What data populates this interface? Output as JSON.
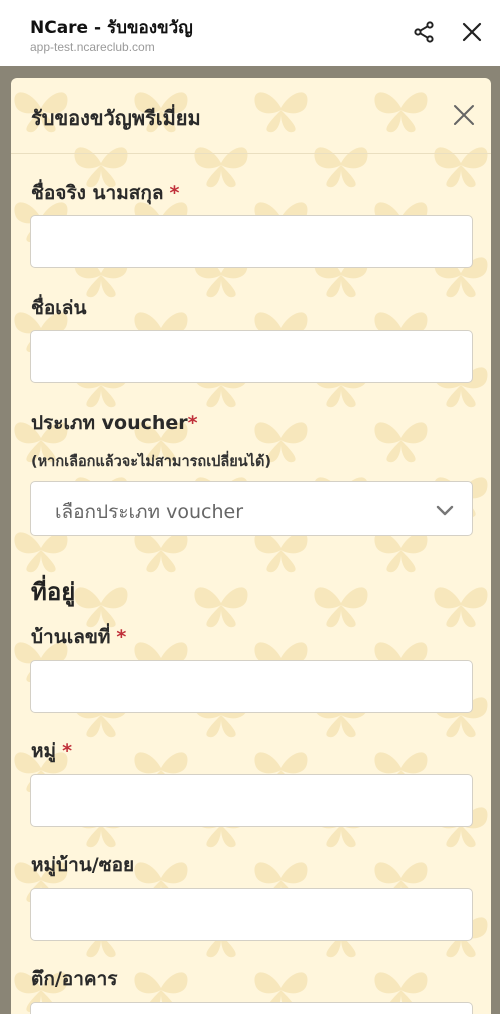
{
  "app": {
    "title": "NCare - รับของขวัญ",
    "url": "app-test.ncareclub.com",
    "share_icon": "share-icon",
    "close_icon": "close-icon"
  },
  "modal": {
    "title": "รับของขวัญพรีเมี่ยม",
    "close_icon": "close-icon",
    "background_color": "#fff6dc",
    "pattern_icon": "butterfly-icon"
  },
  "form": {
    "full_name": {
      "label": "ชื่อจริง นามสกุล",
      "required_mark": "*",
      "value": ""
    },
    "nickname": {
      "label": "ชื่อเล่น",
      "value": ""
    },
    "voucher_type": {
      "label": "ประเภท voucher",
      "required_mark": "*",
      "note": "(หากเลือกแล้วจะไม่สามารถเปลี่ยนได้)",
      "selected": "เลือกประเภท voucher",
      "icon": "chevron-down-icon"
    },
    "address_section": "ที่อยู่",
    "house_no": {
      "label": "บ้านเลขที่",
      "required_mark": "*",
      "value": ""
    },
    "moo": {
      "label": "หมู่",
      "required_mark": "*",
      "value": ""
    },
    "village_soi": {
      "label": "หมู่บ้าน/ซอย",
      "value": ""
    },
    "building": {
      "label": "ตึก/อาคาร",
      "value": ""
    }
  },
  "colors": {
    "required": "#c0303a",
    "overlay": "#8a8576"
  }
}
